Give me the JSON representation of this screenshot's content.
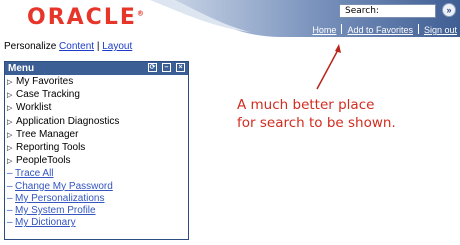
{
  "logo": {
    "text": "ORACLE",
    "trademark": "®"
  },
  "colors": {
    "brand_red": "#e8352a",
    "header_blue": "#3b5f95",
    "link_blue": "#1a3cc8",
    "annotation_red": "#d22c1f"
  },
  "search": {
    "label": "Search:",
    "go_icon": "»"
  },
  "top_links": [
    "Home",
    "Add to Favorites",
    "Sign out"
  ],
  "personalize": {
    "prefix": "Personalize ",
    "content": "Content",
    "separator": " | ",
    "layout": "Layout"
  },
  "menu": {
    "title": "Menu",
    "buttons": {
      "refresh": "⟳",
      "minimize": "–",
      "close": "×"
    },
    "folders": [
      "My Favorites",
      "Case Tracking",
      "Worklist",
      "Application Diagnostics",
      "Tree Manager",
      "Reporting Tools",
      "PeopleTools"
    ],
    "links": [
      "Trace All",
      "Change My Password",
      "My Personalizations",
      "My System Profile",
      "My Dictionary"
    ]
  },
  "annotation": {
    "line1": "A much better place",
    "line2": "for search to be shown."
  }
}
